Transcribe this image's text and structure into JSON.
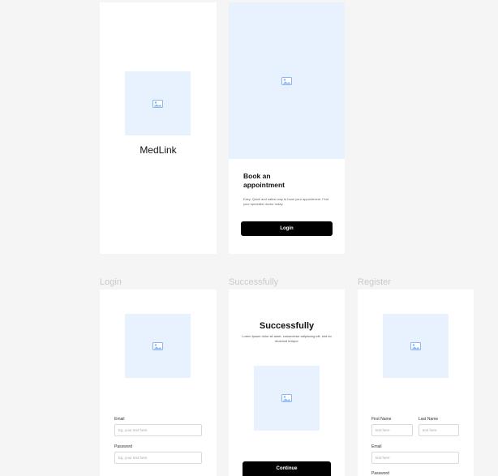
{
  "splash": {
    "app_name": "MedLink"
  },
  "onboarding": {
    "heading": "Book an appointment",
    "description": "Easy, Quick and safest way to book your appointment. Find your specialist doctor today.",
    "login_button": "Login"
  },
  "login": {
    "frame_label": "Login",
    "email_label": "Email",
    "email_placeholder": "Eg. your text here",
    "password_label": "Password",
    "password_placeholder": "Eg. your text here"
  },
  "success": {
    "frame_label": "Successfully",
    "title": "Successfully",
    "description": "Lorem ipsum dolor sit amet, consectetur adipiscing elit, sed do eiusmod tempor",
    "continue_button": "Continue"
  },
  "register": {
    "frame_label": "Register",
    "first_name_label": "First Name",
    "first_name_placeholder": "text here",
    "last_name_label": "Last Name",
    "last_name_placeholder": "text here",
    "email_label": "Email",
    "email_placeholder": "text here",
    "password_label": "Password"
  },
  "colors": {
    "placeholder_bg": "#e8f1fe",
    "button_bg": "#000000",
    "frame_label": "#c9c9c9"
  }
}
